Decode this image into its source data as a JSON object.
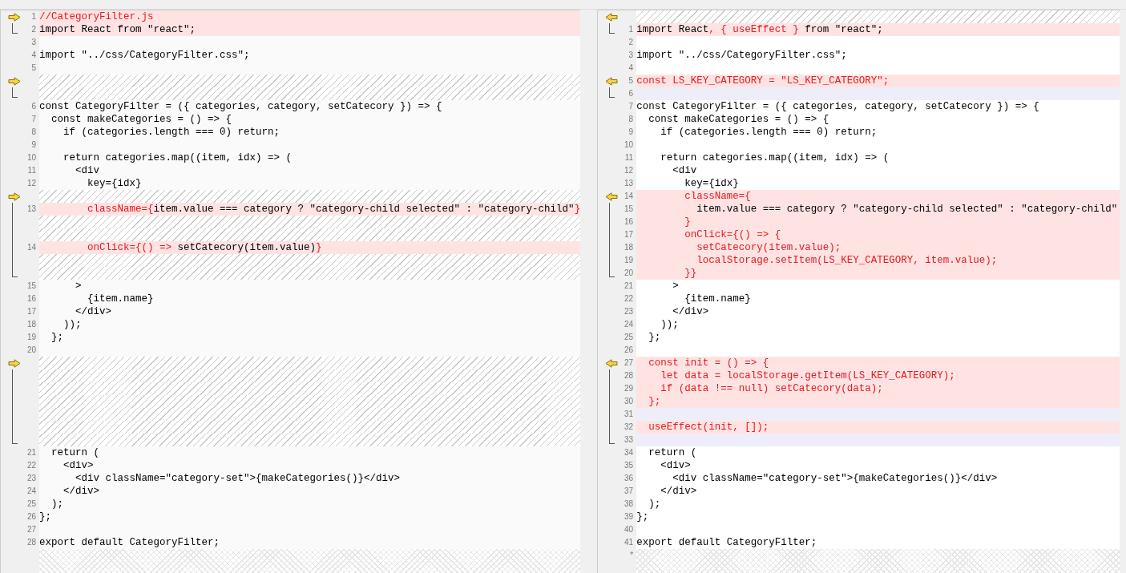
{
  "panes": [
    {
      "kind": "left",
      "rows": [
        {
          "kind": "changed",
          "number": "1",
          "marker": true,
          "segments": [
            {
              "text": "//CategoryFilter.js",
              "changed": true
            }
          ]
        },
        {
          "kind": "changed",
          "number": "2",
          "bracket_end": true,
          "segments": [
            {
              "text": "import React from \"react\";",
              "changed": false
            }
          ]
        },
        {
          "kind": "same",
          "number": "3",
          "segments": []
        },
        {
          "kind": "same",
          "number": "4",
          "segments": [
            {
              "text": "import \"../css/CategoryFilter.css\";",
              "changed": false
            }
          ]
        },
        {
          "kind": "same",
          "number": "5",
          "segments": []
        },
        {
          "kind": "filler",
          "marker": true
        },
        {
          "kind": "filler",
          "bracket_end": true
        },
        {
          "kind": "same",
          "number": "6",
          "segments": [
            {
              "text": "const CategoryFilter = ({ categories, category, setCatecory }) => {",
              "changed": false
            }
          ]
        },
        {
          "kind": "same",
          "number": "7",
          "segments": [
            {
              "text": "  const makeCategories = () => {",
              "changed": false
            }
          ]
        },
        {
          "kind": "same",
          "number": "8",
          "segments": [
            {
              "text": "    if (categories.length === 0) return;",
              "changed": false
            }
          ]
        },
        {
          "kind": "same",
          "number": "9",
          "segments": []
        },
        {
          "kind": "same",
          "number": "10",
          "segments": [
            {
              "text": "    return categories.map((item, idx) => (",
              "changed": false
            }
          ]
        },
        {
          "kind": "same",
          "number": "11",
          "segments": [
            {
              "text": "      <div",
              "changed": false
            }
          ]
        },
        {
          "kind": "same",
          "number": "12",
          "segments": [
            {
              "text": "        key={idx}",
              "changed": false
            }
          ]
        },
        {
          "kind": "filler",
          "marker": true
        },
        {
          "kind": "changed",
          "number": "13",
          "bracket": true,
          "segments": [
            {
              "text": "        className={",
              "changed": true
            },
            {
              "text": "item.value === category ? \"category-child selected\" : \"category-child\"",
              "changed": false
            },
            {
              "text": "}",
              "changed": true
            }
          ]
        },
        {
          "kind": "filler",
          "bracket": true
        },
        {
          "kind": "filler",
          "bracket": true
        },
        {
          "kind": "changed",
          "number": "14",
          "bracket": true,
          "segments": [
            {
              "text": "        onClick={() =>",
              "changed": true
            },
            {
              "text": " setCatecory(item.value)",
              "changed": false
            },
            {
              "text": "}",
              "changed": true
            }
          ]
        },
        {
          "kind": "filler",
          "bracket": true
        },
        {
          "kind": "filler",
          "bracket_end": true
        },
        {
          "kind": "same",
          "number": "15",
          "segments": [
            {
              "text": "      >",
              "changed": false
            }
          ]
        },
        {
          "kind": "same",
          "number": "16",
          "segments": [
            {
              "text": "        {item.name}",
              "changed": false
            }
          ]
        },
        {
          "kind": "same",
          "number": "17",
          "segments": [
            {
              "text": "      </div>",
              "changed": false
            }
          ]
        },
        {
          "kind": "same",
          "number": "18",
          "segments": [
            {
              "text": "    ));",
              "changed": false
            }
          ]
        },
        {
          "kind": "same",
          "number": "19",
          "segments": [
            {
              "text": "  };",
              "changed": false
            }
          ]
        },
        {
          "kind": "same",
          "number": "20",
          "segments": []
        },
        {
          "kind": "filler",
          "marker": true
        },
        {
          "kind": "filler",
          "bracket": true
        },
        {
          "kind": "filler",
          "bracket": true
        },
        {
          "kind": "filler",
          "bracket": true
        },
        {
          "kind": "filler",
          "bracket": true
        },
        {
          "kind": "filler",
          "bracket": true
        },
        {
          "kind": "filler",
          "bracket_end": true
        },
        {
          "kind": "same",
          "number": "21",
          "segments": [
            {
              "text": "  return (",
              "changed": false
            }
          ]
        },
        {
          "kind": "same",
          "number": "22",
          "segments": [
            {
              "text": "    <div>",
              "changed": false
            }
          ]
        },
        {
          "kind": "same",
          "number": "23",
          "segments": [
            {
              "text": "      <div className=\"category-set\">{makeCategories()}</div>",
              "changed": false
            }
          ]
        },
        {
          "kind": "same",
          "number": "24",
          "segments": [
            {
              "text": "    </div>",
              "changed": false
            }
          ]
        },
        {
          "kind": "same",
          "number": "25",
          "segments": [
            {
              "text": "  );",
              "changed": false
            }
          ]
        },
        {
          "kind": "same",
          "number": "26",
          "segments": [
            {
              "text": "};",
              "changed": false
            }
          ]
        },
        {
          "kind": "same",
          "number": "27",
          "segments": []
        },
        {
          "kind": "same",
          "number": "28",
          "segments": [
            {
              "text": "export default CategoryFilter;",
              "changed": false
            }
          ]
        },
        {
          "kind": "end"
        }
      ]
    },
    {
      "kind": "right",
      "rows": [
        {
          "kind": "filler",
          "marker": true
        },
        {
          "kind": "changed",
          "number": "1",
          "bracket_end": true,
          "segments": [
            {
              "text": "import React",
              "changed": false
            },
            {
              "text": ", { useEffect }",
              "changed": true
            },
            {
              "text": " from \"react\";",
              "changed": false
            }
          ]
        },
        {
          "kind": "same",
          "number": "2",
          "segments": []
        },
        {
          "kind": "same",
          "number": "3",
          "segments": [
            {
              "text": "import \"../css/CategoryFilter.css\";",
              "changed": false
            }
          ]
        },
        {
          "kind": "same",
          "number": "4",
          "segments": []
        },
        {
          "kind": "changed",
          "number": "5",
          "marker": true,
          "segments": [
            {
              "text": "const LS_KEY_CATEGORY = \"LS_KEY_CATEGORY\";",
              "changed": true
            }
          ]
        },
        {
          "kind": "padding",
          "number": "6",
          "bracket_end": true,
          "segments": []
        },
        {
          "kind": "same",
          "number": "7",
          "segments": [
            {
              "text": "const CategoryFilter = ({ categories, category, setCatecory }) => {",
              "changed": false
            }
          ]
        },
        {
          "kind": "same",
          "number": "8",
          "segments": [
            {
              "text": "  const makeCategories = () => {",
              "changed": false
            }
          ]
        },
        {
          "kind": "same",
          "number": "9",
          "segments": [
            {
              "text": "    if (categories.length === 0) return;",
              "changed": false
            }
          ]
        },
        {
          "kind": "same",
          "number": "10",
          "segments": []
        },
        {
          "kind": "same",
          "number": "11",
          "segments": [
            {
              "text": "    return categories.map((item, idx) => (",
              "changed": false
            }
          ]
        },
        {
          "kind": "same",
          "number": "12",
          "segments": [
            {
              "text": "      <div",
              "changed": false
            }
          ]
        },
        {
          "kind": "same",
          "number": "13",
          "segments": [
            {
              "text": "        key={idx}",
              "changed": false
            }
          ]
        },
        {
          "kind": "changed",
          "number": "14",
          "marker": true,
          "segments": [
            {
              "text": "        className={",
              "changed": true
            }
          ]
        },
        {
          "kind": "changed",
          "number": "15",
          "bracket": true,
          "segments": [
            {
              "text": "          item.value === category ? \"category-child selected\" : \"category-child\"",
              "changed": false
            }
          ]
        },
        {
          "kind": "changed",
          "number": "16",
          "bracket": true,
          "segments": [
            {
              "text": "        }",
              "changed": true
            }
          ]
        },
        {
          "kind": "changed",
          "number": "17",
          "bracket": true,
          "segments": [
            {
              "text": "        onClick={() => {",
              "changed": true
            }
          ]
        },
        {
          "kind": "changed",
          "number": "18",
          "bracket": true,
          "segments": [
            {
              "text": "          setCatecory(item.value);",
              "changed": true
            }
          ]
        },
        {
          "kind": "changed",
          "number": "19",
          "bracket": true,
          "segments": [
            {
              "text": "          localStorage.setItem(LS_KEY_CATEGORY, item.value);",
              "changed": true
            }
          ]
        },
        {
          "kind": "changed",
          "number": "20",
          "bracket_end": true,
          "segments": [
            {
              "text": "        }}",
              "changed": true
            }
          ]
        },
        {
          "kind": "same",
          "number": "21",
          "segments": [
            {
              "text": "      >",
              "changed": false
            }
          ]
        },
        {
          "kind": "same",
          "number": "22",
          "segments": [
            {
              "text": "        {item.name}",
              "changed": false
            }
          ]
        },
        {
          "kind": "same",
          "number": "23",
          "segments": [
            {
              "text": "      </div>",
              "changed": false
            }
          ]
        },
        {
          "kind": "same",
          "number": "24",
          "segments": [
            {
              "text": "    ));",
              "changed": false
            }
          ]
        },
        {
          "kind": "same",
          "number": "25",
          "segments": [
            {
              "text": "  };",
              "changed": false
            }
          ]
        },
        {
          "kind": "same",
          "number": "26",
          "segments": []
        },
        {
          "kind": "changed",
          "number": "27",
          "marker": true,
          "segments": [
            {
              "text": "  const init = () => {",
              "changed": true
            }
          ]
        },
        {
          "kind": "changed",
          "number": "28",
          "bracket": true,
          "segments": [
            {
              "text": "    let data = localStorage.getItem(LS_KEY_CATEGORY);",
              "changed": true
            }
          ]
        },
        {
          "kind": "changed",
          "number": "29",
          "bracket": true,
          "segments": [
            {
              "text": "    if (data !== null) setCatecory(data);",
              "changed": true
            }
          ]
        },
        {
          "kind": "changed",
          "number": "30",
          "bracket": true,
          "segments": [
            {
              "text": "  };",
              "changed": true
            }
          ]
        },
        {
          "kind": "padding",
          "number": "31",
          "bracket": true,
          "segments": []
        },
        {
          "kind": "changed",
          "number": "32",
          "bracket": true,
          "segments": [
            {
              "text": "  useEffect(init, []);",
              "changed": true
            }
          ]
        },
        {
          "kind": "padding",
          "number": "33",
          "bracket_end": true,
          "segments": []
        },
        {
          "kind": "same",
          "number": "34",
          "segments": [
            {
              "text": "  return (",
              "changed": false
            }
          ]
        },
        {
          "kind": "same",
          "number": "35",
          "segments": [
            {
              "text": "    <div>",
              "changed": false
            }
          ]
        },
        {
          "kind": "same",
          "number": "36",
          "segments": [
            {
              "text": "      <div className=\"category-set\">{makeCategories()}</div>",
              "changed": false
            }
          ]
        },
        {
          "kind": "same",
          "number": "37",
          "segments": [
            {
              "text": "    </div>",
              "changed": false
            }
          ]
        },
        {
          "kind": "same",
          "number": "38",
          "segments": [
            {
              "text": "  );",
              "changed": false
            }
          ]
        },
        {
          "kind": "same",
          "number": "39",
          "segments": [
            {
              "text": "};",
              "changed": false
            }
          ]
        },
        {
          "kind": "same",
          "number": "40",
          "segments": []
        },
        {
          "kind": "same",
          "number": "41",
          "segments": [
            {
              "text": "export default CategoryFilter;",
              "changed": false
            }
          ]
        },
        {
          "kind": "end",
          "number": "*"
        }
      ]
    }
  ]
}
